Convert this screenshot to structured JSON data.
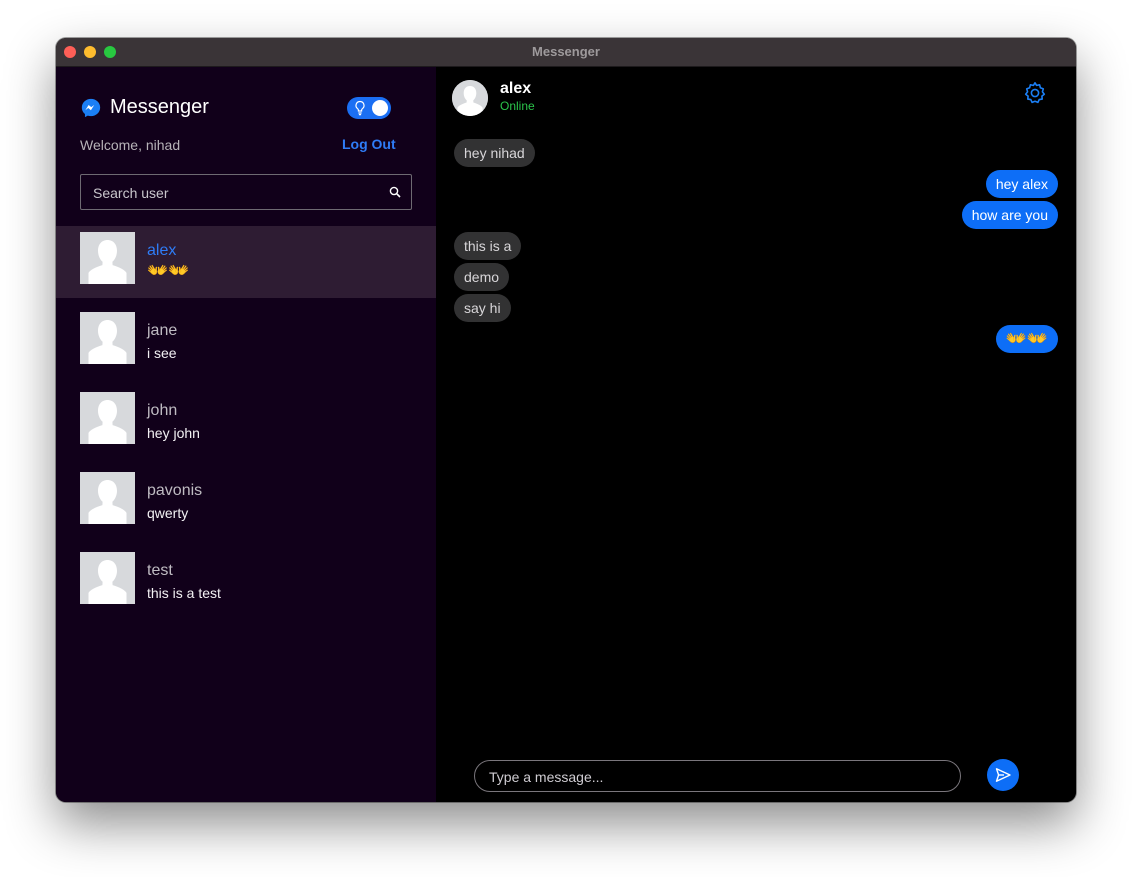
{
  "window": {
    "title": "Messenger"
  },
  "sidebar": {
    "brand": "Messenger",
    "welcome": "Welcome, nihad",
    "logout_label": "Log Out",
    "search_placeholder": "Search user",
    "theme_toggle_on": true,
    "users": [
      {
        "name": "alex",
        "last_message": "👐👐",
        "active": true
      },
      {
        "name": "jane",
        "last_message": "i see",
        "active": false
      },
      {
        "name": "john",
        "last_message": "hey john",
        "active": false
      },
      {
        "name": "pavonis",
        "last_message": "qwerty",
        "active": false
      },
      {
        "name": "test",
        "last_message": "this is a test",
        "active": false
      }
    ]
  },
  "chat": {
    "contact_name": "alex",
    "status": "Online",
    "messages": [
      {
        "text": "hey nihad",
        "direction": "in"
      },
      {
        "text": "hey alex",
        "direction": "out"
      },
      {
        "text": "how are you",
        "direction": "out"
      },
      {
        "text": "this is a",
        "direction": "in"
      },
      {
        "text": "demo",
        "direction": "in"
      },
      {
        "text": "say hi",
        "direction": "in"
      },
      {
        "text": "👐👐",
        "direction": "out"
      }
    ],
    "composer_placeholder": "Type a message..."
  },
  "colors": {
    "accent": "#0d6ef7",
    "sidebar_bg": "#11001a",
    "active_row_bg": "#2e1c33",
    "incoming_bubble": "#323233",
    "online": "#2bc54b"
  },
  "icons": {
    "brand": "messenger-logo-icon",
    "toggle": "lightbulb-icon",
    "search": "search-icon",
    "settings": "gear-icon",
    "send": "send-icon",
    "avatar": "person-silhouette-icon"
  }
}
